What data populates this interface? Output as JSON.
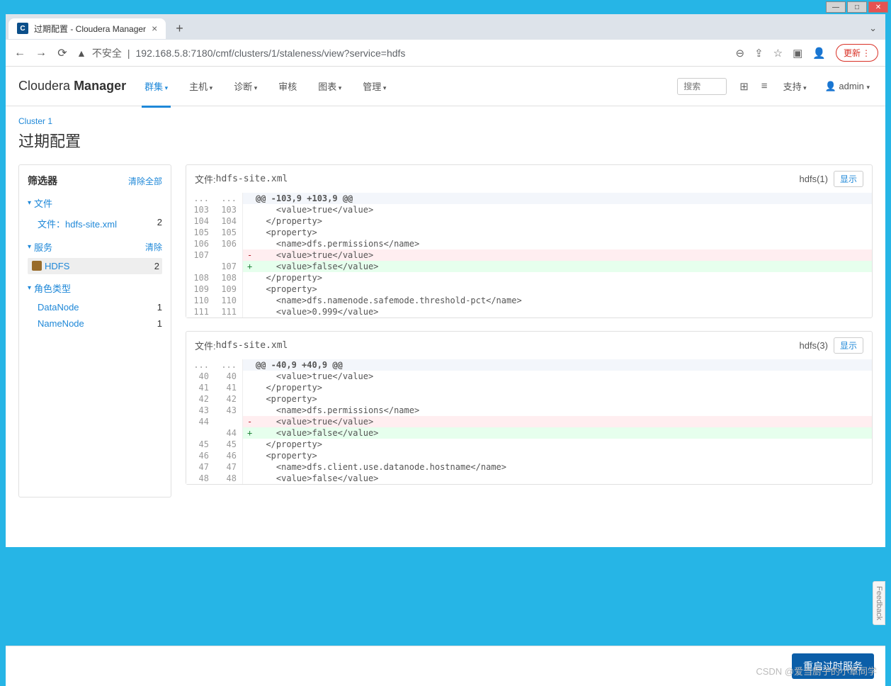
{
  "window": {
    "tab_title": "过期配置 - Cloudera Manager",
    "url_prefix": "不安全",
    "url": "192.168.5.8:7180/cmf/clusters/1/staleness/view?service=hdfs",
    "update_label": "更新"
  },
  "topnav": {
    "logo_light": "Cloudera",
    "logo_bold": "Manager",
    "items": [
      "群集",
      "主机",
      "诊断",
      "审核",
      "图表",
      "管理"
    ],
    "search_placeholder": "搜索",
    "support": "支持",
    "user": "admin"
  },
  "page": {
    "breadcrumb": "Cluster 1",
    "title": "过期配置",
    "restart_button": "重启过时服务",
    "feedback": "Feedback"
  },
  "sidebar": {
    "title": "筛选器",
    "clear_all": "清除全部",
    "groups": [
      {
        "label": "文件",
        "clear": "",
        "items": [
          {
            "label": "文件：hdfs-site.xml",
            "count": "2",
            "selected": false,
            "icon": false
          }
        ]
      },
      {
        "label": "服务",
        "clear": "清除",
        "items": [
          {
            "label": "HDFS",
            "count": "2",
            "selected": true,
            "icon": true
          }
        ]
      },
      {
        "label": "角色类型",
        "clear": "",
        "items": [
          {
            "label": "DataNode",
            "count": "1",
            "selected": false,
            "icon": false
          },
          {
            "label": "NameNode",
            "count": "1",
            "selected": false,
            "icon": false
          }
        ]
      }
    ]
  },
  "diffs": [
    {
      "file_label": "文件:",
      "file_name": "hdfs-site.xml",
      "badge": "hdfs(1)",
      "show_label": "显示",
      "rows": [
        {
          "type": "ctx",
          "oln": "...",
          "nln": "...",
          "text": "@@ -103,9 +103,9 @@"
        },
        {
          "type": "same",
          "oln": "103",
          "nln": "103",
          "text": "    <value>true</value>"
        },
        {
          "type": "same",
          "oln": "104",
          "nln": "104",
          "text": "  </property>"
        },
        {
          "type": "same",
          "oln": "105",
          "nln": "105",
          "text": "  <property>"
        },
        {
          "type": "same",
          "oln": "106",
          "nln": "106",
          "text": "    <name>dfs.permissions</name>"
        },
        {
          "type": "del",
          "oln": "107",
          "nln": "",
          "text": "    <value>true</value>"
        },
        {
          "type": "add",
          "oln": "",
          "nln": "107",
          "text": "    <value>false</value>"
        },
        {
          "type": "same",
          "oln": "108",
          "nln": "108",
          "text": "  </property>"
        },
        {
          "type": "same",
          "oln": "109",
          "nln": "109",
          "text": "  <property>"
        },
        {
          "type": "same",
          "oln": "110",
          "nln": "110",
          "text": "    <name>dfs.namenode.safemode.threshold-pct</name>"
        },
        {
          "type": "same",
          "oln": "111",
          "nln": "111",
          "text": "    <value>0.999</value>"
        }
      ]
    },
    {
      "file_label": "文件:",
      "file_name": "hdfs-site.xml",
      "badge": "hdfs(3)",
      "show_label": "显示",
      "rows": [
        {
          "type": "ctx",
          "oln": "...",
          "nln": "...",
          "text": "@@ -40,9 +40,9 @@"
        },
        {
          "type": "same",
          "oln": "40",
          "nln": "40",
          "text": "    <value>true</value>"
        },
        {
          "type": "same",
          "oln": "41",
          "nln": "41",
          "text": "  </property>"
        },
        {
          "type": "same",
          "oln": "42",
          "nln": "42",
          "text": "  <property>"
        },
        {
          "type": "same",
          "oln": "43",
          "nln": "43",
          "text": "    <name>dfs.permissions</name>"
        },
        {
          "type": "del",
          "oln": "44",
          "nln": "",
          "text": "    <value>true</value>"
        },
        {
          "type": "add",
          "oln": "",
          "nln": "44",
          "text": "    <value>false</value>"
        },
        {
          "type": "same",
          "oln": "45",
          "nln": "45",
          "text": "  </property>"
        },
        {
          "type": "same",
          "oln": "46",
          "nln": "46",
          "text": "  <property>"
        },
        {
          "type": "same",
          "oln": "47",
          "nln": "47",
          "text": "    <name>dfs.client.use.datanode.hostname</name>"
        },
        {
          "type": "same",
          "oln": "48",
          "nln": "48",
          "text": "    <value>false</value>"
        }
      ]
    }
  ],
  "watermark": "CSDN @爱当厨子的小章同学"
}
